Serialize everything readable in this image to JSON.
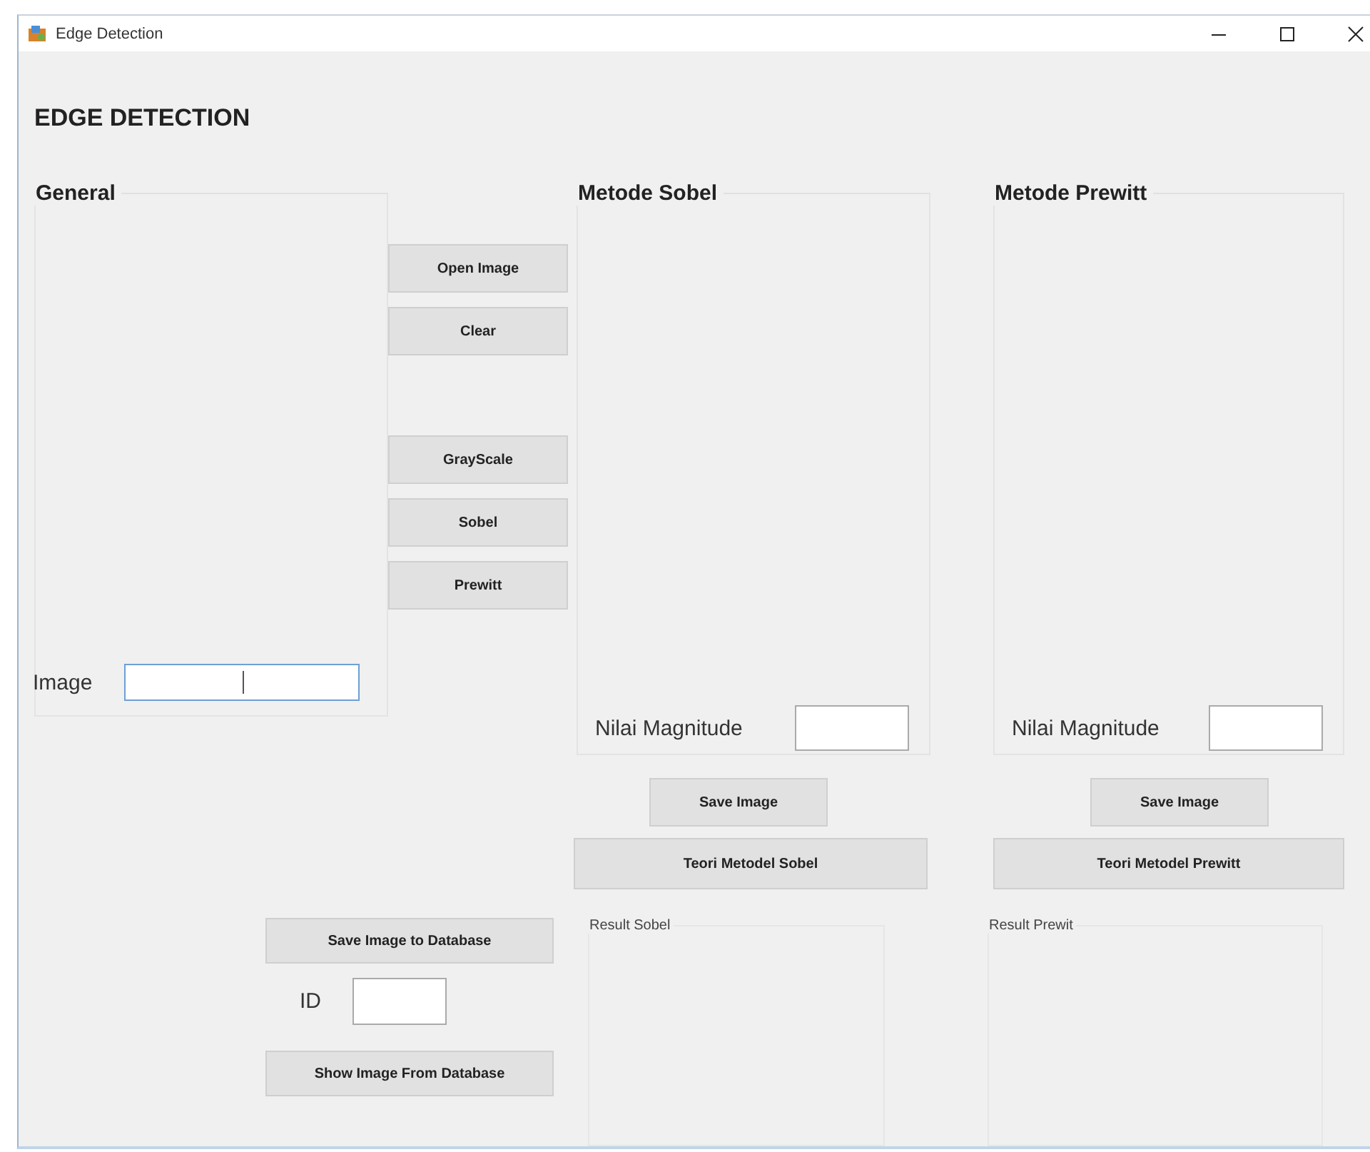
{
  "window": {
    "title": "Edge Detection"
  },
  "heading": "EDGE DETECTION",
  "general": {
    "title": "General",
    "image_label": "Image"
  },
  "file_buttons": [
    {
      "label": "Open Image"
    },
    {
      "label": "Clear"
    }
  ],
  "process_buttons": [
    {
      "label": "GrayScale"
    },
    {
      "label": "Sobel"
    },
    {
      "label": "Prewitt"
    }
  ],
  "methods": [
    {
      "title": "Metode Sobel",
      "magnitude_label": "Nilai Magnitude",
      "save_button": "Save Image",
      "theory_button": "Teori Metodel Sobel",
      "result_title": "Result Sobel"
    },
    {
      "title": "Metode Prewitt",
      "magnitude_label": "Nilai Magnitude",
      "save_button": "Save Image",
      "theory_button": "Teori Metodel Prewitt",
      "result_title": "Result Prewit"
    }
  ],
  "database": {
    "save_button": "Save Image to Database",
    "id_label": "ID",
    "show_button": "Show Image From Database"
  }
}
